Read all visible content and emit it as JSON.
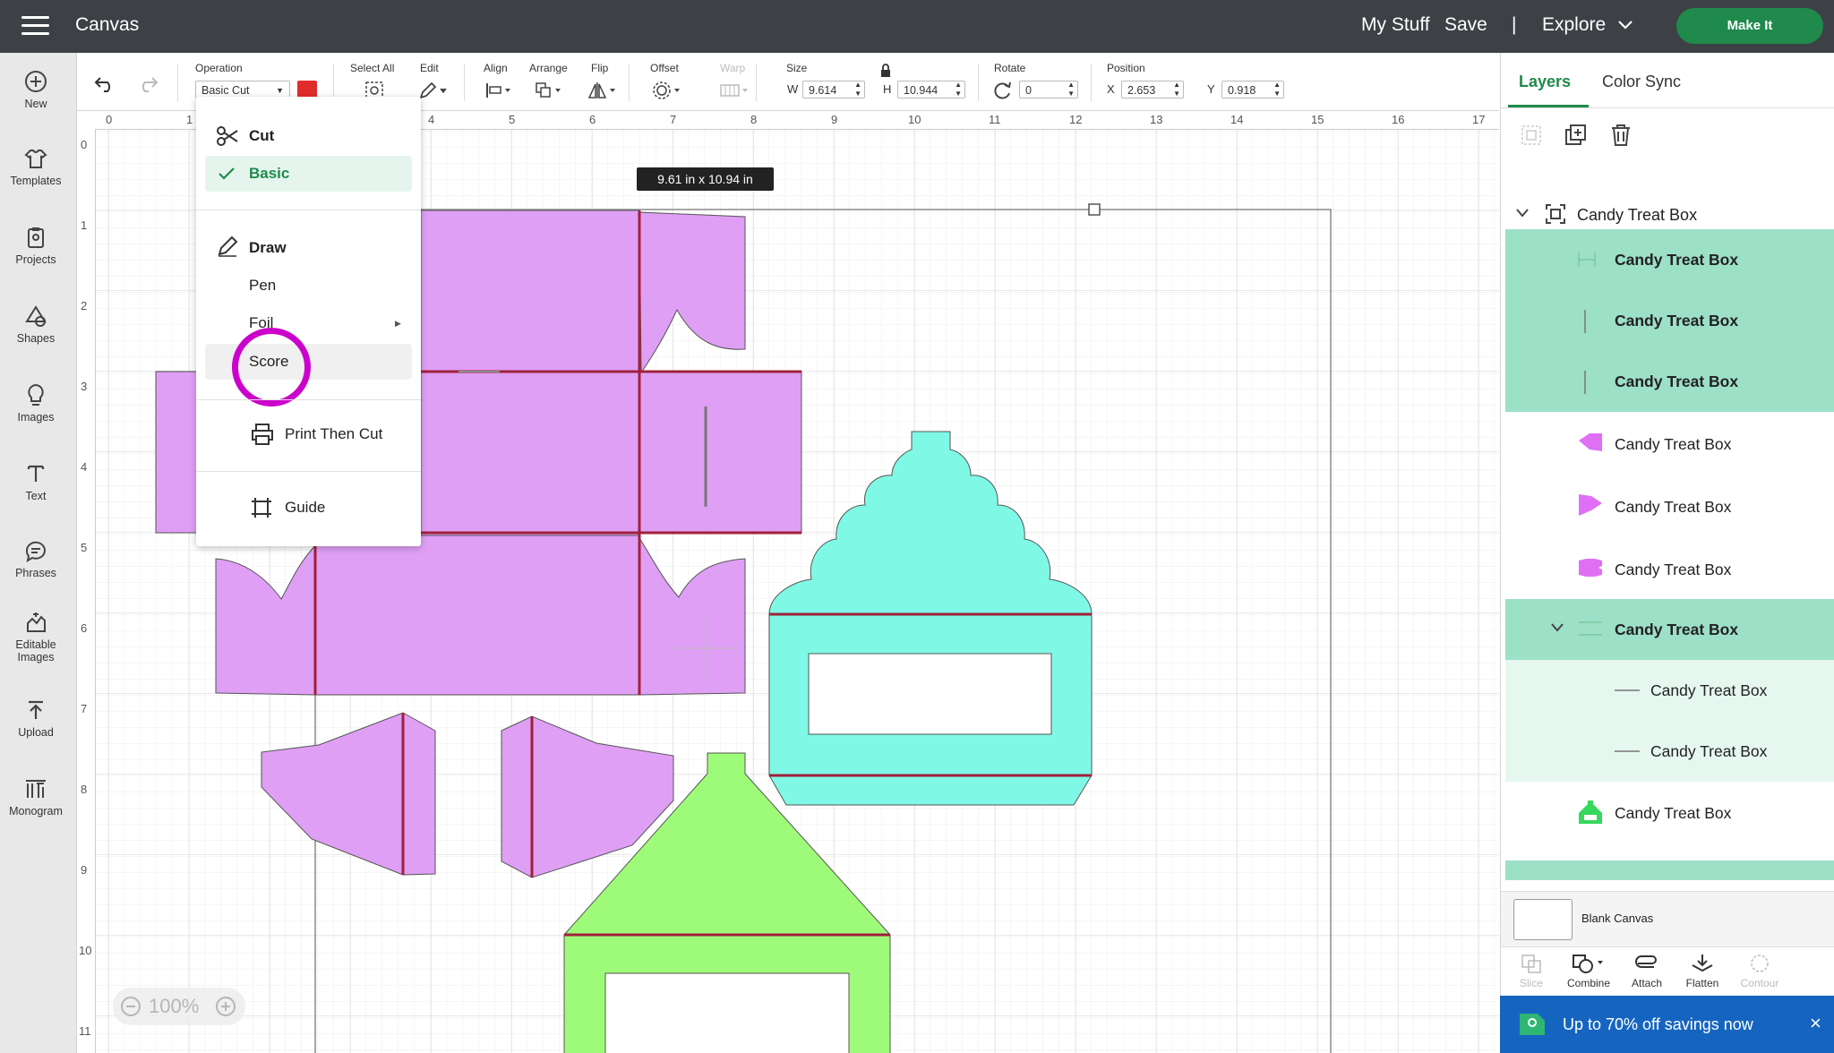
{
  "app": {
    "title": "Canvas"
  },
  "topbar": {
    "my_stuff": "My Stuff",
    "save": "Save",
    "divider": "|",
    "explore": "Explore",
    "make_it": "Make It"
  },
  "sidebar": {
    "items": [
      {
        "label": "New",
        "icon": "plus-circle-icon"
      },
      {
        "label": "Templates",
        "icon": "tshirt-icon"
      },
      {
        "label": "Projects",
        "icon": "clipboard-icon"
      },
      {
        "label": "Shapes",
        "icon": "shapes-icon"
      },
      {
        "label": "Images",
        "icon": "lightbulb-icon"
      },
      {
        "label": "Text",
        "icon": "text-icon"
      },
      {
        "label": "Phrases",
        "icon": "speech-bubble-icon"
      },
      {
        "label": "Editable Images",
        "icon": "editable-image-icon"
      },
      {
        "label": "Upload",
        "icon": "upload-icon"
      },
      {
        "label": "Monogram",
        "icon": "monogram-icon"
      }
    ]
  },
  "toolbar": {
    "operation_label": "Operation",
    "operation_value": "Basic Cut",
    "operation_color": "#e02c2c",
    "select_all": "Select All",
    "edit": "Edit",
    "align": "Align",
    "arrange": "Arrange",
    "flip": "Flip",
    "offset": "Offset",
    "warp": "Warp",
    "size": "Size",
    "w_label": "W",
    "w_value": "9.614",
    "h_label": "H",
    "h_value": "10.944",
    "rotate": "Rotate",
    "rotate_value": "0",
    "position": "Position",
    "x_label": "X",
    "x_value": "2.653",
    "y_label": "Y",
    "y_value": "0.918"
  },
  "rulers": {
    "top": [
      "0",
      "1",
      "4",
      "5",
      "6",
      "7",
      "8",
      "9",
      "10",
      "11",
      "12",
      "13",
      "14",
      "15",
      "16",
      "17"
    ],
    "left": [
      "0",
      "1",
      "2",
      "3",
      "4",
      "5",
      "6",
      "7",
      "8",
      "9",
      "10",
      "11"
    ]
  },
  "canvas": {
    "size_tooltip": "9.61  in x 10.94  in",
    "zoom": "100%"
  },
  "operation_menu": {
    "cut": "Cut",
    "basic": "Basic",
    "draw": "Draw",
    "pen": "Pen",
    "foil": "Foil",
    "score": "Score",
    "print_then_cut": "Print Then Cut",
    "guide": "Guide"
  },
  "right_panel": {
    "tabs": [
      "Layers",
      "Color Sync"
    ],
    "group_name": "Candy Treat Box",
    "layers": [
      {
        "label": "Candy Treat Box",
        "bold": true
      },
      {
        "label": "Candy Treat Box",
        "bold": true
      },
      {
        "label": "Candy Treat Box",
        "bold": true
      },
      {
        "label": "Candy Treat Box",
        "bold": false
      },
      {
        "label": "Candy Treat Box",
        "bold": false
      },
      {
        "label": "Candy Treat Box",
        "bold": false
      },
      {
        "label": "Candy Treat Box",
        "bold": true
      },
      {
        "label": "Candy Treat Box",
        "bold": false
      },
      {
        "label": "Candy Treat Box",
        "bold": false
      },
      {
        "label": "Candy Treat Box",
        "bold": false
      }
    ],
    "blank_canvas": "Blank Canvas",
    "bottom_tools": [
      "Slice",
      "Combine",
      "Attach",
      "Flatten",
      "Contour"
    ]
  },
  "promo": {
    "text": "Up to 70% off savings now",
    "close": "×"
  },
  "colors": {
    "purple": "#df9ff5",
    "teal": "#7ff9e6",
    "green": "#9efb79",
    "score_line": "#a1203a",
    "accent": "#1f8a4c",
    "highlight": "#cc00cc"
  }
}
